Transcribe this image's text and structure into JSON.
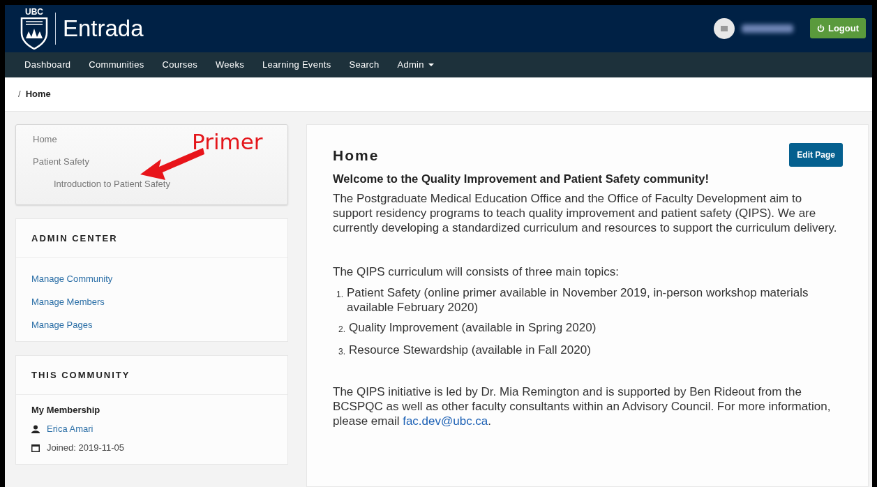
{
  "header": {
    "logo_text": "UBC",
    "app_name": "Entrada",
    "logout_label": "Logout"
  },
  "nav": [
    {
      "label": "Dashboard",
      "dropdown": false
    },
    {
      "label": "Communities",
      "dropdown": false
    },
    {
      "label": "Courses",
      "dropdown": false
    },
    {
      "label": "Weeks",
      "dropdown": false
    },
    {
      "label": "Learning Events",
      "dropdown": false
    },
    {
      "label": "Search",
      "dropdown": false
    },
    {
      "label": "Admin",
      "dropdown": true
    }
  ],
  "breadcrumb": {
    "separator": "/",
    "current": "Home"
  },
  "page_menu": {
    "items": [
      {
        "label": "Home"
      },
      {
        "label": "Patient Safety",
        "children": [
          {
            "label": "Introduction to Patient Safety"
          }
        ]
      }
    ]
  },
  "annotation": {
    "text": "Primer"
  },
  "admin_center": {
    "title": "ADMIN CENTER",
    "links": [
      "Manage Community",
      "Manage Members",
      "Manage Pages"
    ]
  },
  "this_community": {
    "title": "THIS COMMUNITY",
    "subtitle": "My Membership",
    "member_name": "Erica Amari",
    "joined": "Joined: 2019-11-05"
  },
  "main": {
    "title": "Home",
    "edit_button": "Edit Page",
    "welcome": "Welcome to the Quality Improvement and Patient Safety community!",
    "intro": "The Postgraduate Medical Education Office and the Office of Faculty Development aim to support residency programs to teach quality improvement and patient safety (QIPS). We are currently developing a standardized curriculum and resources to support the curriculum delivery.",
    "topics_lead": "The QIPS curriculum will consists of three main topics:",
    "topics": [
      {
        "marker": "1.",
        "text": "Patient Safety (online primer available in November 2019, in-person workshop materials available February 2020)"
      },
      {
        "marker": "2.",
        "text": "Quality Improvement (available in Spring 2020)"
      },
      {
        "marker": "3.",
        "text": "Resource Stewardship (available in Fall 2020)"
      }
    ],
    "closing": "The QIPS initiative is led by Dr. Mia Remington and is supported by Ben Rideout from the BCSPQC as well as other faculty consultants within an Advisory Council. For more information, please email ",
    "email": "fac.dev@ubc.ca",
    "closing_end": "."
  }
}
